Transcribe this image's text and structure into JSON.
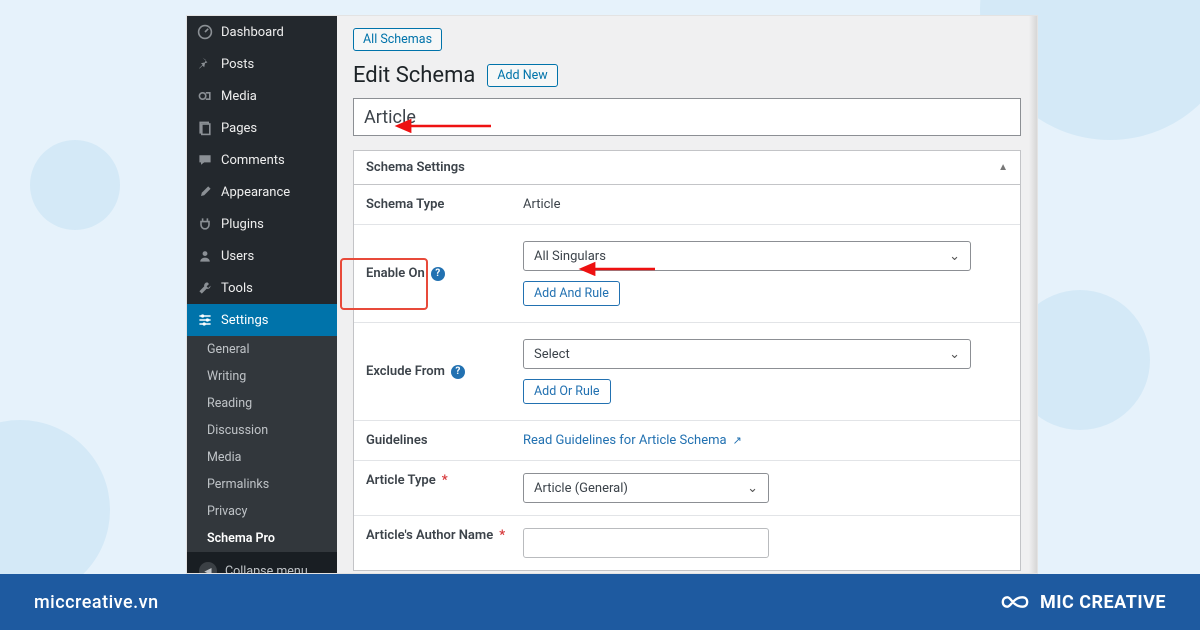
{
  "footer": {
    "site": "miccreative.vn",
    "brand": "MIC CREATIVE"
  },
  "sidebar": {
    "items": [
      {
        "label": "Dashboard",
        "icon": "dashboard"
      },
      {
        "label": "Posts",
        "icon": "pin"
      },
      {
        "label": "Media",
        "icon": "media"
      },
      {
        "label": "Pages",
        "icon": "pages"
      },
      {
        "label": "Comments",
        "icon": "comment"
      },
      {
        "label": "Appearance",
        "icon": "brush"
      },
      {
        "label": "Plugins",
        "icon": "plug"
      },
      {
        "label": "Users",
        "icon": "user"
      },
      {
        "label": "Tools",
        "icon": "wrench"
      },
      {
        "label": "Settings",
        "icon": "sliders",
        "active": true
      }
    ],
    "sub": [
      "General",
      "Writing",
      "Reading",
      "Discussion",
      "Media",
      "Permalinks",
      "Privacy",
      "Schema Pro"
    ],
    "collapse": "Collapse menu"
  },
  "topchip": "All Schemas",
  "page_title": "Edit Schema",
  "addnew": "Add New",
  "title_value": "Article",
  "panel": {
    "heading": "Schema Settings",
    "schema_type_label": "Schema Type",
    "schema_type_value": "Article",
    "enable_on_label": "Enable On",
    "enable_on_value": "All Singulars",
    "add_and_rule": "Add And Rule",
    "exclude_label": "Exclude From",
    "exclude_value": "Select",
    "add_or_rule": "Add Or Rule",
    "guidelines_label": "Guidelines",
    "guidelines_link": "Read Guidelines for Article Schema",
    "article_type_label": "Article Type",
    "article_type_value": "Article (General)",
    "author_label": "Article's Author Name"
  }
}
